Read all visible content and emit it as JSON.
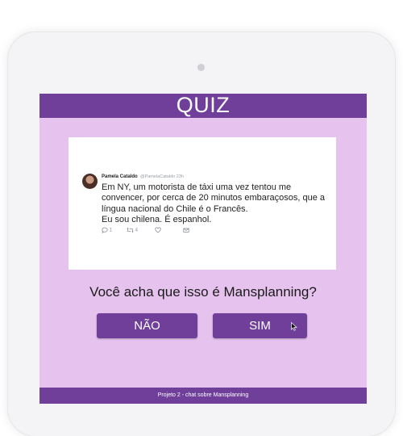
{
  "header": {
    "title": "QUIZ"
  },
  "tweet": {
    "author_name": "Pamela Cataldo",
    "author_meta": "@PamelaCataldo 23h",
    "text_line_1": "Em NY, um motorista de táxi uma vez tentou me",
    "text_line_2": "convencer, por cerca de 20 minutos embaraçosos, que a",
    "text_line_3": "língua nacional do Chile é o Francês.",
    "text_line_4": "Eu sou chilena. É espanhol.",
    "reply_count": "1",
    "retweet_count": "4"
  },
  "quiz": {
    "question": "Você acha que isso é Mansplanning?",
    "no_label": "NÃO",
    "yes_label": "SIM"
  },
  "footer": {
    "text": "Projeto 2 - chat sobre Mansplanning"
  },
  "colors": {
    "primary_purple": "#6f3f9a",
    "background_lilac": "#e6c3ee",
    "card_white": "#ffffff"
  },
  "icons": [
    "reply-icon",
    "retweet-icon",
    "like-icon",
    "message-icon",
    "mouse-cursor-icon"
  ]
}
